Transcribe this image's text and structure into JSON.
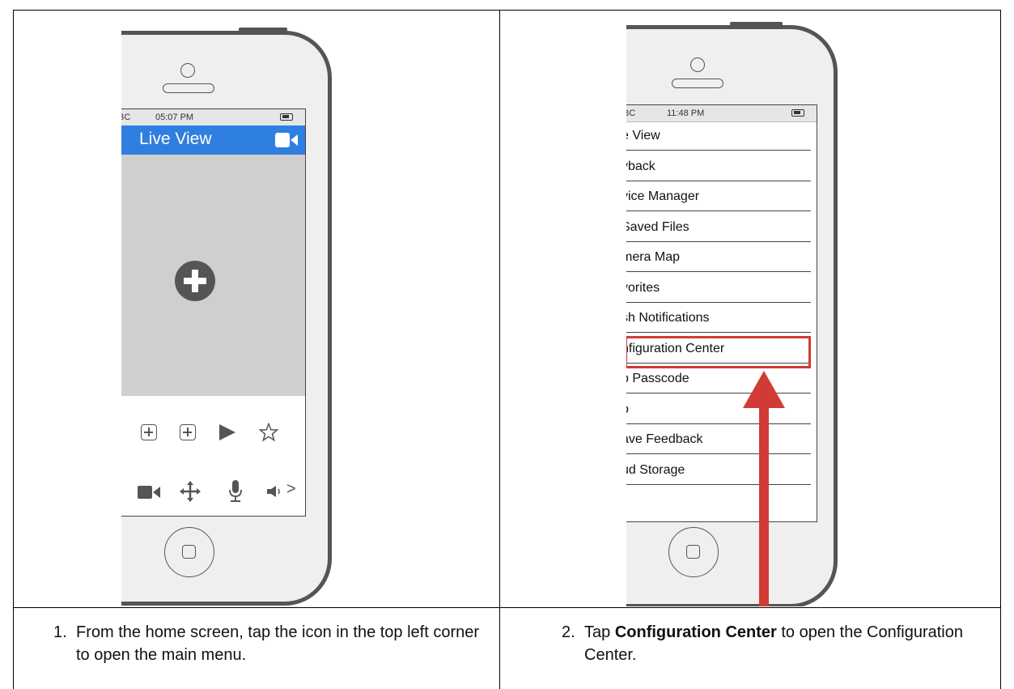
{
  "left_panel": {
    "status": {
      "carrier": "BC",
      "time": "05:07 PM"
    },
    "header_title": "Live View",
    "toolbar_bottom_more": ">",
    "caption_number": "1.",
    "caption_text": "From the home screen, tap the icon in the top left corner to open the main menu."
  },
  "right_panel": {
    "status": {
      "carrier": "BC",
      "time": "11:48 PM"
    },
    "menu_items": [
      "e View",
      "yback",
      "vice Manager",
      " Saved Files",
      "mera Map",
      "vorites",
      "sh Notifications",
      "nfiguration Center",
      "p Passcode",
      "p",
      "ave Feedback",
      "ud Storage"
    ],
    "highlighted_index": 7,
    "caption_number": "2.",
    "caption_prefix": "Tap ",
    "caption_bold": "Configuration Center",
    "caption_suffix": " to open the Configuration Center."
  },
  "colors": {
    "header_blue": "#2f7fe0",
    "arrow_red": "#d23b35",
    "phone_gray": "#555555"
  },
  "icons": {
    "left": [
      "camera-icon",
      "add-circle-icon",
      "add-box-icon",
      "add-box-icon",
      "play-icon",
      "star-icon",
      "video-camera-icon",
      "move-icon",
      "microphone-icon",
      "speaker-icon"
    ],
    "right": [
      "up-arrow-icon"
    ]
  }
}
